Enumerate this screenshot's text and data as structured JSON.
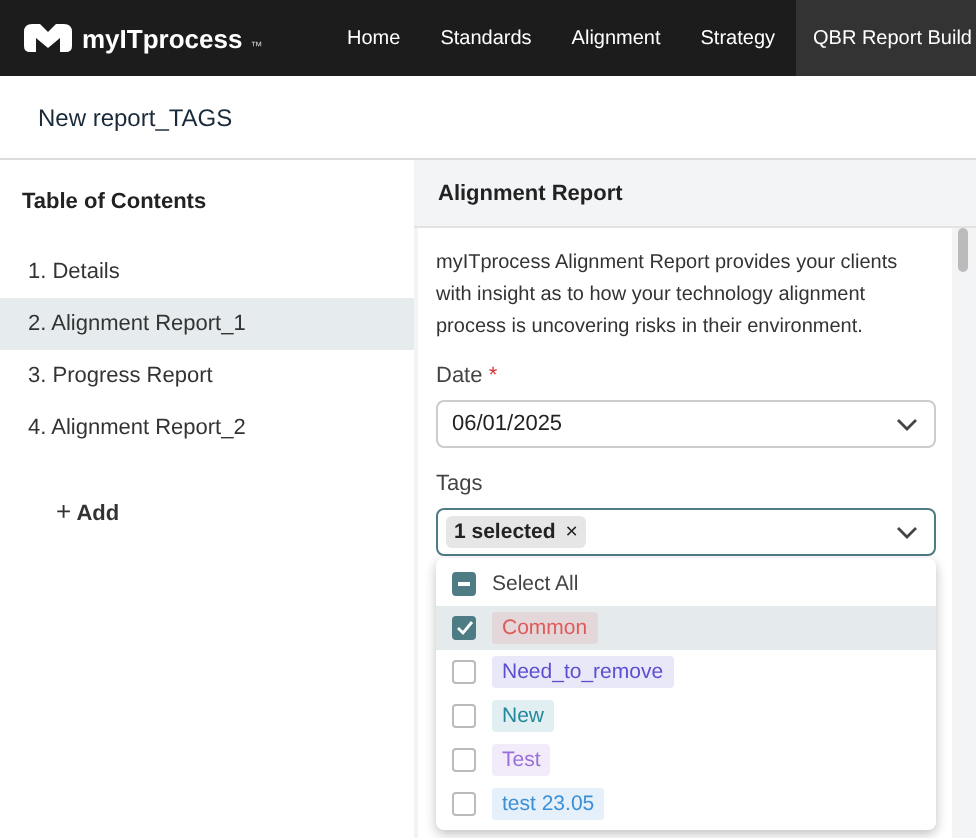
{
  "nav": {
    "logo_text": "myITprocess",
    "trademark": "™",
    "items": [
      {
        "label": "Home",
        "selected": false
      },
      {
        "label": "Standards",
        "selected": false
      },
      {
        "label": "Alignment",
        "selected": false
      },
      {
        "label": "Strategy",
        "selected": false
      },
      {
        "label": "QBR Report Build",
        "selected": true
      }
    ]
  },
  "page_title": "New report_TAGS",
  "toc": {
    "title": "Table of Contents",
    "items": [
      {
        "label": "1. Details",
        "selected": false
      },
      {
        "label": "2. Alignment Report_1",
        "selected": true
      },
      {
        "label": "3. Progress Report",
        "selected": false
      },
      {
        "label": "4. Alignment Report_2",
        "selected": false
      }
    ],
    "add_label": "Add",
    "add_icon": "+"
  },
  "panel": {
    "title": "Alignment Report",
    "description": "myITprocess Alignment Report provides your clients with insight as to how your technology alignment process is uncovering risks in their environment.",
    "date_field": {
      "label": "Date",
      "required_mark": "*",
      "value": "06/01/2025"
    },
    "tags_field": {
      "label": "Tags",
      "chip": "1 selected",
      "chip_remove": "×",
      "expanded": true,
      "select_all": {
        "label": "Select All",
        "indeterminate": true
      },
      "options": [
        {
          "label": "Common",
          "checked": true,
          "color": "#e05a5a"
        },
        {
          "label": "Need_to_remove",
          "checked": false,
          "color": "#5b4fd0"
        },
        {
          "label": "New",
          "checked": false,
          "color": "#23899a"
        },
        {
          "label": "Test",
          "checked": false,
          "color": "#9a6fd6"
        },
        {
          "label": "test 23.05",
          "checked": false,
          "color": "#3a8fd6"
        }
      ]
    }
  }
}
